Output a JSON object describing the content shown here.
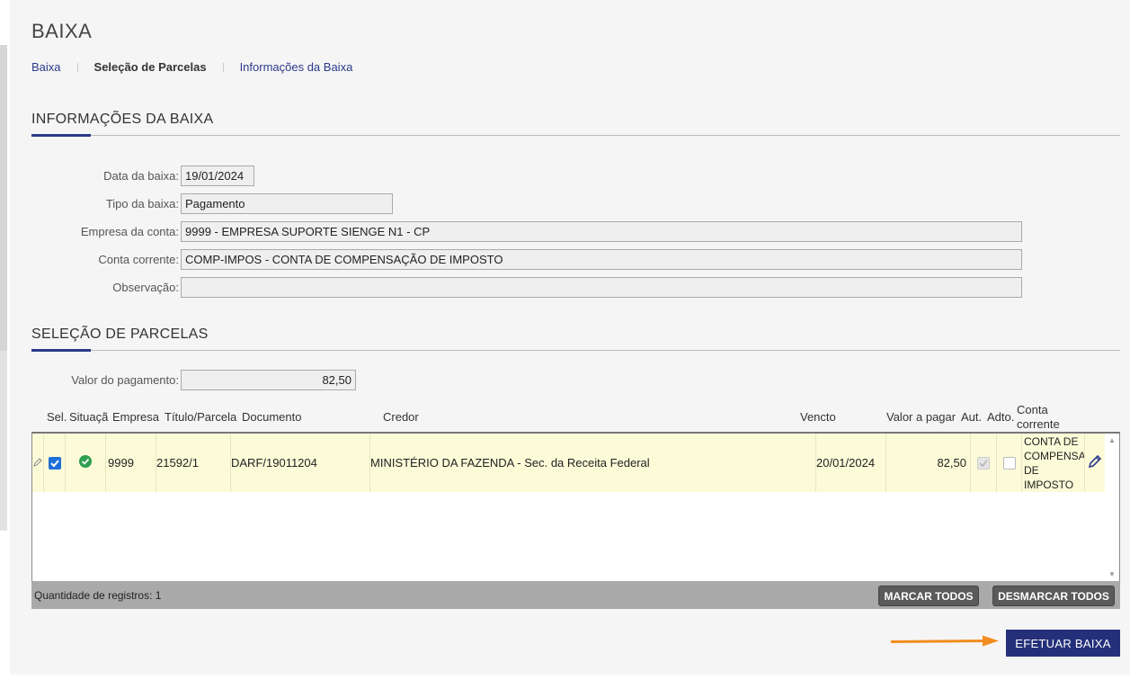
{
  "page": {
    "title": "BAIXA",
    "breadcrumb": [
      {
        "label": "Baixa"
      },
      {
        "label": "Seleção de Parcelas"
      },
      {
        "label": "Informações da Baixa"
      }
    ]
  },
  "info_section": {
    "heading": "INFORMAÇÕES DA BAIXA",
    "fields": {
      "data_label": "Data da baixa:",
      "data_value": "19/01/2024",
      "tipo_label": "Tipo da baixa:",
      "tipo_value": "Pagamento",
      "empresa_label": "Empresa da conta:",
      "empresa_value": "9999 - EMPRESA SUPORTE SIENGE N1 - CP",
      "conta_label": "Conta corrente:",
      "conta_value": "COMP-IMPOS - CONTA DE COMPENSAÇÃO DE IMPOSTO",
      "obs_label": "Observação:",
      "obs_value": ""
    }
  },
  "parcelas_section": {
    "heading": "SELEÇÃO DE PARCELAS",
    "valor_label": "Valor do pagamento:",
    "valor_value": "82,50"
  },
  "grid": {
    "columns": {
      "sel": "Sel.",
      "situacao": "Situaçã",
      "empresa": "Empresa",
      "titulo": "Título/Parcela",
      "documento": "Documento",
      "credor": "Credor",
      "vencto": "Vencto",
      "valor": "Valor a pagar",
      "aut": "Aut.",
      "adto": "Adto.",
      "conta_line1": "Conta",
      "conta_line2": "corrente"
    },
    "rows": [
      {
        "selected": true,
        "situacao": "ok",
        "empresa": "9999",
        "titulo": "21592/1",
        "documento": "DARF/19011204",
        "credor": "MINISTÉRIO DA FAZENDA - Sec. da Receita Federal",
        "vencto": "20/01/2024",
        "valor": "82,50",
        "aut": true,
        "adto": false,
        "conta_lines": [
          "CONTA DE",
          "COMPENSA",
          "DE",
          "IMPOSTO"
        ]
      }
    ],
    "footer": {
      "count_label": "Quantidade de registros: 1",
      "mark_all": "MARCAR TODOS",
      "unmark_all": "DESMARCAR TODOS"
    }
  },
  "actions": {
    "submit": "EFETUAR BAIXA"
  },
  "colors": {
    "primary": "#25307a",
    "accent_arrow": "#f28c1e",
    "row_highlight": "#fbfbd8",
    "check_blue": "#1f6fd8",
    "status_green": "#2e9e4f"
  },
  "icons": [
    "pencil-icon",
    "check-circle-icon",
    "edit-icon",
    "arrow-right-icon"
  ]
}
